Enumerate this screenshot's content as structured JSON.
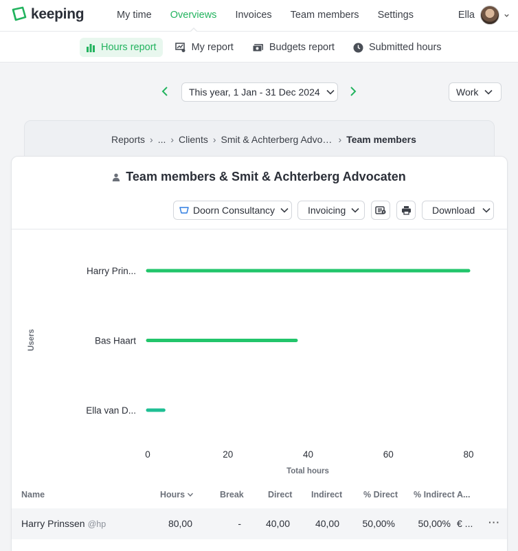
{
  "app": {
    "logo_text": "keeping",
    "brand_color": "#22b35e"
  },
  "mainnav": {
    "items": [
      {
        "label": "My time"
      },
      {
        "label": "Overviews",
        "active": true
      },
      {
        "label": "Invoices"
      },
      {
        "label": "Team members"
      },
      {
        "label": "Settings"
      }
    ]
  },
  "user": {
    "name": "Ella"
  },
  "subnav": {
    "items": [
      {
        "label": "Hours report",
        "icon": "bar-chart-icon",
        "active": true
      },
      {
        "label": "My report",
        "icon": "my-report-icon"
      },
      {
        "label": "Budgets report",
        "icon": "banknote-icon"
      },
      {
        "label": "Submitted hours",
        "icon": "clock-icon"
      }
    ]
  },
  "filters": {
    "date_range": "This year, 1 Jan - 31 Dec 2024",
    "work_type": "Work"
  },
  "breadcrumb": {
    "items": [
      "Reports",
      "...",
      "Clients",
      "Smit & Achterberg Advocaten"
    ],
    "current": "Team members"
  },
  "report": {
    "title": "Team members & Smit & Achterberg Advocaten",
    "customer_filter": "Doorn Consultancy",
    "invoicing_filter": "Invoicing",
    "download_label": "Download"
  },
  "chart_data": {
    "type": "bar",
    "orientation": "horizontal",
    "categories": [
      "Harry Prin...",
      "Bas Haart",
      "Ella van D..."
    ],
    "values": [
      80,
      37,
      4
    ],
    "colors": [
      "#22c56b",
      "#22c56b",
      "#1fbf94"
    ],
    "xlabel": "Total hours",
    "ylabel": "Users",
    "xlim": [
      0,
      80
    ],
    "xticks": [
      0,
      20,
      40,
      60,
      80
    ],
    "grid": false
  },
  "table": {
    "columns": {
      "name": "Name",
      "hours": "Hours",
      "break": "Break",
      "direct": "Direct",
      "indirect": "Indirect",
      "pct_direct": "% Direct",
      "pct_indirect": "% Indirect",
      "amount": "A..."
    },
    "rows": [
      {
        "name": "Harry Prinssen",
        "handle": "@hp",
        "hours": "80,00",
        "break": "-",
        "direct": "40,00",
        "indirect": "40,00",
        "pct_direct": "50,00%",
        "pct_indirect": "50,00%",
        "amount": "€ ...",
        "more": "···"
      }
    ]
  }
}
